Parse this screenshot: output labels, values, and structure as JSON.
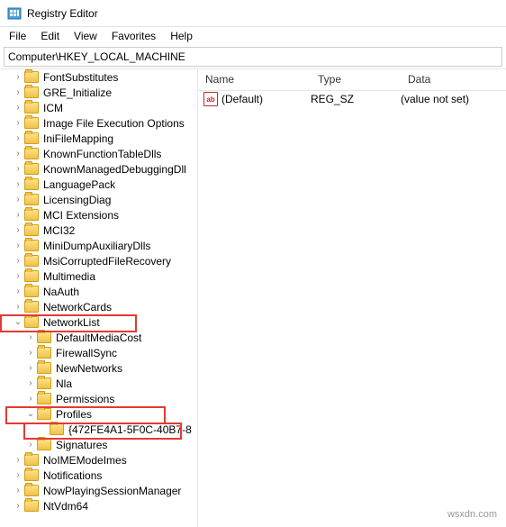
{
  "window": {
    "title": "Registry Editor"
  },
  "menu": {
    "file": "File",
    "edit": "Edit",
    "view": "View",
    "favorites": "Favorites",
    "help": "Help"
  },
  "address": {
    "path": "Computer\\HKEY_LOCAL_MACHINE"
  },
  "columns": {
    "name": "Name",
    "type": "Type",
    "data": "Data"
  },
  "values": [
    {
      "icon": "ab",
      "name": "(Default)",
      "type": "REG_SZ",
      "data": "(value not set)"
    }
  ],
  "tree": [
    {
      "d": 1,
      "e": "r",
      "l": "FontSubstitutes"
    },
    {
      "d": 1,
      "e": "r",
      "l": "GRE_Initialize"
    },
    {
      "d": 1,
      "e": "r",
      "l": "ICM"
    },
    {
      "d": 1,
      "e": "r",
      "l": "Image File Execution Options"
    },
    {
      "d": 1,
      "e": "r",
      "l": "IniFileMapping"
    },
    {
      "d": 1,
      "e": "r",
      "l": "KnownFunctionTableDlls"
    },
    {
      "d": 1,
      "e": "r",
      "l": "KnownManagedDebuggingDll"
    },
    {
      "d": 1,
      "e": "r",
      "l": "LanguagePack"
    },
    {
      "d": 1,
      "e": "r",
      "l": "LicensingDiag"
    },
    {
      "d": 1,
      "e": "r",
      "l": "MCI Extensions"
    },
    {
      "d": 1,
      "e": "r",
      "l": "MCI32"
    },
    {
      "d": 1,
      "e": "r",
      "l": "MiniDumpAuxiliaryDlls"
    },
    {
      "d": 1,
      "e": "r",
      "l": "MsiCorruptedFileRecovery"
    },
    {
      "d": 1,
      "e": "r",
      "l": "Multimedia"
    },
    {
      "d": 1,
      "e": "r",
      "l": "NaAuth"
    },
    {
      "d": 1,
      "e": "r",
      "l": "NetworkCards"
    },
    {
      "d": 1,
      "e": "d",
      "l": "NetworkList"
    },
    {
      "d": 2,
      "e": "r",
      "l": "DefaultMediaCost"
    },
    {
      "d": 2,
      "e": "r",
      "l": "FirewallSync"
    },
    {
      "d": 2,
      "e": "r",
      "l": "NewNetworks"
    },
    {
      "d": 2,
      "e": "r",
      "l": "Nla"
    },
    {
      "d": 2,
      "e": "r",
      "l": "Permissions"
    },
    {
      "d": 2,
      "e": "d",
      "l": "Profiles"
    },
    {
      "d": 3,
      "e": "",
      "l": "{472FE4A1-5F0C-40B7-8"
    },
    {
      "d": 2,
      "e": "r",
      "l": "Signatures"
    },
    {
      "d": 1,
      "e": "r",
      "l": "NoIMEModeImes"
    },
    {
      "d": 1,
      "e": "r",
      "l": "Notifications"
    },
    {
      "d": 1,
      "e": "r",
      "l": "NowPlayingSessionManager"
    },
    {
      "d": 1,
      "e": "r",
      "l": "NtVdm64"
    }
  ],
  "watermark": "wsxdn.com"
}
